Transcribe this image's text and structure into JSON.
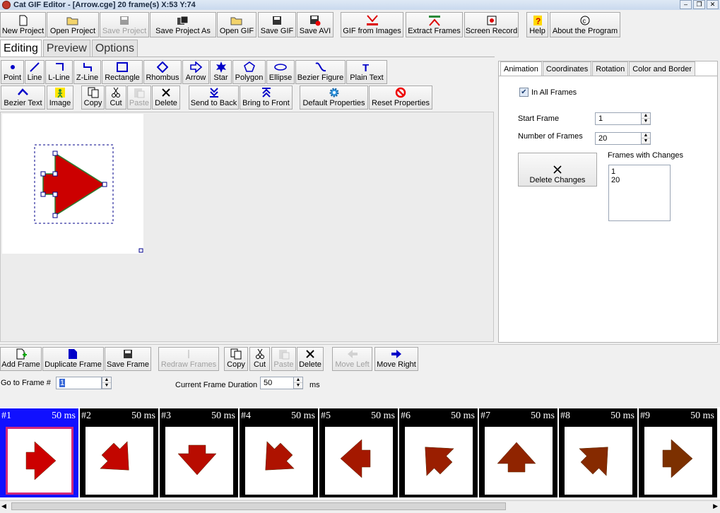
{
  "window": {
    "title": "Cat GIF Editor - [Arrow.cge] 20 frame(s) X:53 Y:74",
    "controls": [
      "–",
      "❐",
      "✕"
    ]
  },
  "toolbar": [
    {
      "label": "New Project",
      "icon": "new-page-icon",
      "enabled": true
    },
    {
      "label": "Open Project",
      "icon": "open-folder-icon",
      "enabled": true
    },
    {
      "label": "Save Project",
      "icon": "disk-icon",
      "enabled": false
    },
    {
      "label": "Save Project As",
      "icon": "save-as-icon",
      "enabled": true
    },
    {
      "label": "Open GIF",
      "icon": "open-folder-icon",
      "enabled": true
    },
    {
      "label": "Save GIF",
      "icon": "disk-icon",
      "enabled": true
    },
    {
      "label": "Save AVI",
      "icon": "disk-red-icon",
      "enabled": true
    },
    {
      "label": "GIF from Images",
      "icon": "merge-icon",
      "enabled": true
    },
    {
      "label": "Extract Frames",
      "icon": "extract-icon",
      "enabled": true
    },
    {
      "label": "Screen Record",
      "icon": "record-icon",
      "enabled": true
    },
    {
      "label": "Help",
      "icon": "help-icon",
      "enabled": true
    },
    {
      "label": "About the Program",
      "icon": "copyright-icon",
      "enabled": true
    }
  ],
  "main_tabs": [
    {
      "label": "Editing",
      "active": true
    },
    {
      "label": "Preview",
      "active": false
    },
    {
      "label": "Options",
      "active": false
    }
  ],
  "draw_tools": [
    {
      "label": "Point",
      "icon": "point-icon"
    },
    {
      "label": "Line",
      "icon": "line-icon"
    },
    {
      "label": "L-Line",
      "icon": "l-line-icon"
    },
    {
      "label": "Z-Line",
      "icon": "z-line-icon"
    },
    {
      "label": "Rectangle",
      "icon": "rectangle-icon"
    },
    {
      "label": "Rhombus",
      "icon": "rhombus-icon"
    },
    {
      "label": "Arrow",
      "icon": "arrow-icon"
    },
    {
      "label": "Star",
      "icon": "star-icon"
    },
    {
      "label": "Polygon",
      "icon": "polygon-icon"
    },
    {
      "label": "Ellipse",
      "icon": "ellipse-icon"
    },
    {
      "label": "Bezier Figure",
      "icon": "bezier-figure-icon"
    },
    {
      "label": "Plain Text",
      "icon": "text-icon"
    }
  ],
  "edit_tools": [
    {
      "label": "Bezier Text",
      "icon": "bezier-text-icon",
      "enabled": true
    },
    {
      "label": "Image",
      "icon": "image-icon",
      "enabled": true
    },
    {
      "label": "Copy",
      "icon": "copy-icon",
      "enabled": true
    },
    {
      "label": "Cut",
      "icon": "scissors-icon",
      "enabled": true
    },
    {
      "label": "Paste",
      "icon": "paste-icon",
      "enabled": false
    },
    {
      "label": "Delete",
      "icon": "delete-x-icon",
      "enabled": true
    },
    {
      "label": "Send to Back",
      "icon": "send-back-icon",
      "enabled": true
    },
    {
      "label": "Bring to Front",
      "icon": "bring-front-icon",
      "enabled": true
    },
    {
      "label": "Default Properties",
      "icon": "gear-icon",
      "enabled": true
    },
    {
      "label": "Reset Properties",
      "icon": "no-icon",
      "enabled": true
    }
  ],
  "right_panel": {
    "tabs": [
      {
        "label": "Animation",
        "active": true
      },
      {
        "label": "Coordinates",
        "active": false
      },
      {
        "label": "Rotation",
        "active": false
      },
      {
        "label": "Color and Border",
        "active": false
      }
    ],
    "in_all_frames": {
      "label": "In All Frames",
      "checked": true
    },
    "start_frame": {
      "label": "Start Frame",
      "value": "1"
    },
    "number_of_frames": {
      "label": "Number of Frames",
      "value": "20"
    },
    "delete_changes_label": "Delete Changes",
    "frames_with_changes": {
      "label": "Frames with Changes",
      "items": [
        "1",
        "20"
      ]
    }
  },
  "frame_toolbar": [
    {
      "label": "Add Frame",
      "icon": "add-frame-icon",
      "enabled": true
    },
    {
      "label": "Duplicate Frame",
      "icon": "duplicate-icon",
      "enabled": true
    },
    {
      "label": "Save Frame",
      "icon": "disk-icon",
      "enabled": true
    },
    {
      "label": "Redraw Frames",
      "icon": "redraw-icon",
      "enabled": false
    },
    {
      "label": "Copy",
      "icon": "copy-icon",
      "enabled": true
    },
    {
      "label": "Cut",
      "icon": "scissors-icon",
      "enabled": true
    },
    {
      "label": "Paste",
      "icon": "paste-icon",
      "enabled": false
    },
    {
      "label": "Delete",
      "icon": "delete-x-icon",
      "enabled": true
    },
    {
      "label": "Move Left",
      "icon": "arrow-left-icon",
      "enabled": false
    },
    {
      "label": "Move Right",
      "icon": "arrow-right-icon",
      "enabled": true
    }
  ],
  "goto_frame": {
    "label": "Go to Frame #",
    "value": "1"
  },
  "frame_duration": {
    "label": "Current Frame Duration",
    "value": "50",
    "unit": "ms"
  },
  "frames": [
    {
      "num": "#1",
      "dur": "50 ms",
      "selected": true
    },
    {
      "num": "#2",
      "dur": "50 ms",
      "selected": false
    },
    {
      "num": "#3",
      "dur": "50 ms",
      "selected": false
    },
    {
      "num": "#4",
      "dur": "50 ms",
      "selected": false
    },
    {
      "num": "#5",
      "dur": "50 ms",
      "selected": false
    },
    {
      "num": "#6",
      "dur": "50 ms",
      "selected": false
    },
    {
      "num": "#7",
      "dur": "50 ms",
      "selected": false
    },
    {
      "num": "#8",
      "dur": "50 ms",
      "selected": false
    },
    {
      "num": "#9",
      "dur": "50 ms",
      "selected": false
    }
  ],
  "colors": {
    "arrow_fill": "#cc0000",
    "arrow_stroke": "#2e7d32",
    "selected_frame": "#1010ff",
    "frame_bg": "#000000"
  }
}
